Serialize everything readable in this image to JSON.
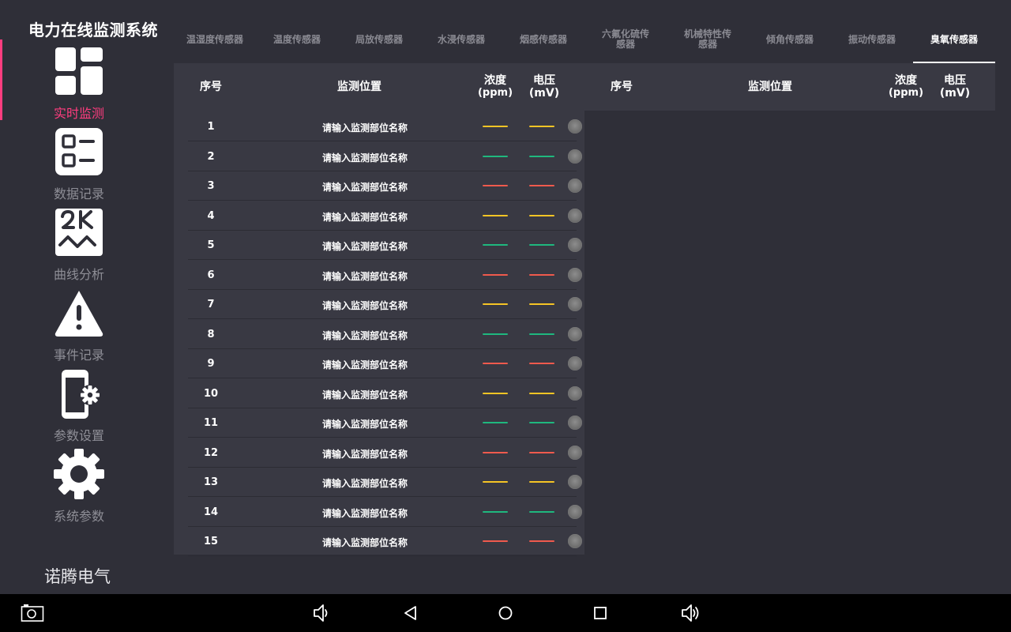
{
  "app": {
    "title": "电力在线监测系统",
    "brand": "诺腾电气"
  },
  "sidebar": {
    "items": [
      {
        "label": "实时监测",
        "icon": "dashboard-icon",
        "active": true
      },
      {
        "label": "数据记录",
        "icon": "checklist-icon",
        "active": false
      },
      {
        "label": "曲线分析",
        "icon": "2k-curve-icon",
        "active": false
      },
      {
        "label": "事件记录",
        "icon": "warning-icon",
        "active": false
      },
      {
        "label": "参数设置",
        "icon": "phone-settings-icon",
        "active": false
      },
      {
        "label": "系统参数",
        "icon": "gear-icon",
        "active": false
      }
    ]
  },
  "tabs": [
    {
      "label": "温湿度传感器",
      "active": false
    },
    {
      "label": "温度传感器",
      "active": false
    },
    {
      "label": "局放传感器",
      "active": false
    },
    {
      "label": "水浸传感器",
      "active": false
    },
    {
      "label": "烟感传感器",
      "active": false
    },
    {
      "label": "六氟化硫传感器",
      "active": false
    },
    {
      "label": "机械特性传感器",
      "active": false
    },
    {
      "label": "倾角传感器",
      "active": false
    },
    {
      "label": "振动传感器",
      "active": false
    },
    {
      "label": "臭氧传感器",
      "active": true
    }
  ],
  "table": {
    "headers": {
      "no": "序号",
      "location": "监测位置",
      "concentration": "浓度",
      "concentration_unit": "(ppm)",
      "voltage": "电压(mV)"
    },
    "rows": [
      {
        "no": "1",
        "location": "请输入监测部位名称",
        "status": "yellow"
      },
      {
        "no": "2",
        "location": "请输入监测部位名称",
        "status": "green"
      },
      {
        "no": "3",
        "location": "请输入监测部位名称",
        "status": "red"
      },
      {
        "no": "4",
        "location": "请输入监测部位名称",
        "status": "yellow"
      },
      {
        "no": "5",
        "location": "请输入监测部位名称",
        "status": "green"
      },
      {
        "no": "6",
        "location": "请输入监测部位名称",
        "status": "red"
      },
      {
        "no": "7",
        "location": "请输入监测部位名称",
        "status": "yellow"
      },
      {
        "no": "8",
        "location": "请输入监测部位名称",
        "status": "green"
      },
      {
        "no": "9",
        "location": "请输入监测部位名称",
        "status": "red"
      },
      {
        "no": "10",
        "location": "请输入监测部位名称",
        "status": "yellow"
      },
      {
        "no": "11",
        "location": "请输入监测部位名称",
        "status": "green"
      },
      {
        "no": "12",
        "location": "请输入监测部位名称",
        "status": "red"
      },
      {
        "no": "13",
        "location": "请输入监测部位名称",
        "status": "yellow"
      },
      {
        "no": "14",
        "location": "请输入监测部位名称",
        "status": "green"
      },
      {
        "no": "15",
        "location": "请输入监测部位名称",
        "status": "red"
      }
    ]
  },
  "colors": {
    "accent": "#ff3d7f",
    "yellow": "#f5c425",
    "green": "#1fb87e",
    "red": "#ef5a4d",
    "background": "#2f2f38",
    "panel": "#393943"
  },
  "system_nav": {
    "icons": [
      "screenshot-icon",
      "volume-down-icon",
      "back-icon",
      "home-icon",
      "recents-icon",
      "volume-up-icon"
    ]
  }
}
